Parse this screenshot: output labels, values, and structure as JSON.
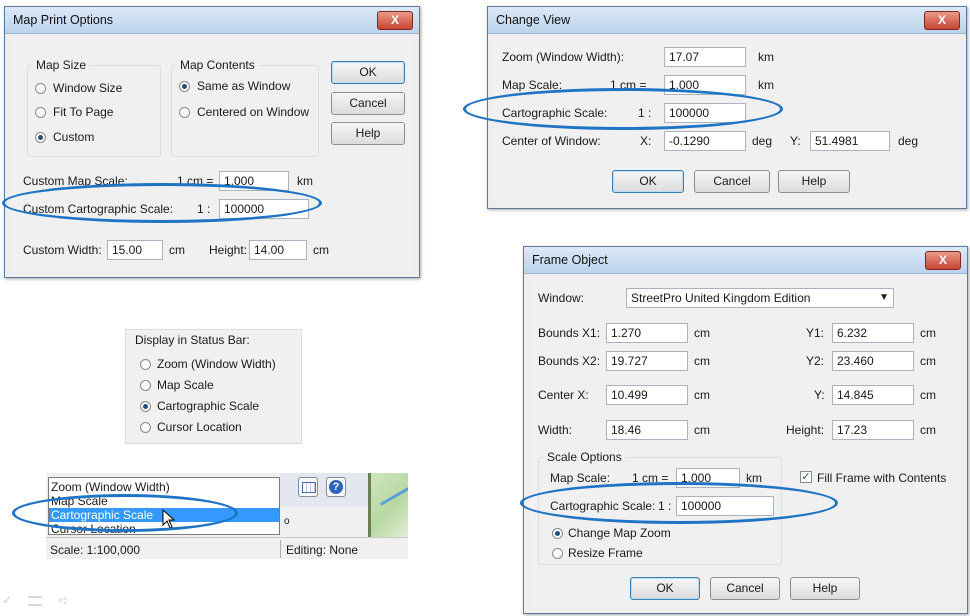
{
  "map_print_options": {
    "title": "Map Print Options",
    "close": "X",
    "map_size_group": "Map Size",
    "map_size_options": [
      "Window Size",
      "Fit To Page",
      "Custom"
    ],
    "map_contents_group": "Map Contents",
    "map_contents_options": [
      "Same as Window",
      "Centered on Window"
    ],
    "ok": "OK",
    "cancel": "Cancel",
    "help": "Help",
    "custom_map_scale_label": "Custom Map Scale:",
    "cm_eq": "1 cm =",
    "map_scale_value": "1.000",
    "km": "km",
    "custom_carto_label": "Custom Cartographic Scale:",
    "one_colon": "1 :",
    "carto_value": "100000",
    "custom_width_label": "Custom Width:",
    "width_value": "15.00",
    "cm": "cm",
    "height_label": "Height:",
    "height_value": "14.00"
  },
  "change_view": {
    "title": "Change View",
    "close": "X",
    "zoom_label": "Zoom (Window Width):",
    "zoom_value": "17.07",
    "km": "km",
    "map_scale_label": "Map Scale:",
    "cm_eq": "1 cm =",
    "map_scale_value": "1.000",
    "carto_label": "Cartographic Scale:",
    "one_colon": "1 :",
    "carto_value": "100000",
    "center_label": "Center of Window:",
    "x_label": "X:",
    "x_value": "-0.1290",
    "deg": "deg",
    "y_label": "Y:",
    "y_value": "51.4981",
    "ok": "OK",
    "cancel": "Cancel",
    "help": "Help"
  },
  "status_panel": {
    "title": "Display in Status Bar:",
    "options": [
      "Zoom (Window Width)",
      "Map Scale",
      "Cartographic Scale",
      "Cursor Location"
    ]
  },
  "status_bar": {
    "list": [
      "Zoom (Window Width)",
      "Map Scale",
      "Cartographic Scale",
      "Cursor Location"
    ],
    "scale_text": "Scale: 1:100,000",
    "editing_text": "Editing: None",
    "degree_mark": "o"
  },
  "frame_object": {
    "title": "Frame Object",
    "close": "X",
    "window_label": "Window:",
    "window_value": "StreetPro United Kingdom Edition",
    "bx1_label": "Bounds X1:",
    "bx1_value": "1.270",
    "y1_label": "Y1:",
    "y1_value": "6.232",
    "bx2_label": "Bounds X2:",
    "bx2_value": "19.727",
    "y2_label": "Y2:",
    "y2_value": "23.460",
    "cx_label": "Center X:",
    "cx_value": "10.499",
    "cy_label": "Y:",
    "cy_value": "14.845",
    "width_label": "Width:",
    "width_value": "18.46",
    "height_label": "Height:",
    "height_value": "17.23",
    "cm": "cm",
    "scale_options_group": "Scale Options",
    "map_scale_label": "Map Scale:",
    "cm_eq": "1 cm =",
    "map_scale_value": "1.000",
    "km": "km",
    "fill_label": "Fill Frame with Contents",
    "carto_label": "Cartographic Scale:",
    "one_colon": "1 :",
    "carto_value": "100000",
    "radio_options": [
      "Change Map Zoom",
      "Resize Frame"
    ],
    "ok": "OK",
    "cancel": "Cancel",
    "help": "Help"
  },
  "colors": {
    "highlight_ellipse": "#1e73c4",
    "selection": "#3399ff"
  }
}
